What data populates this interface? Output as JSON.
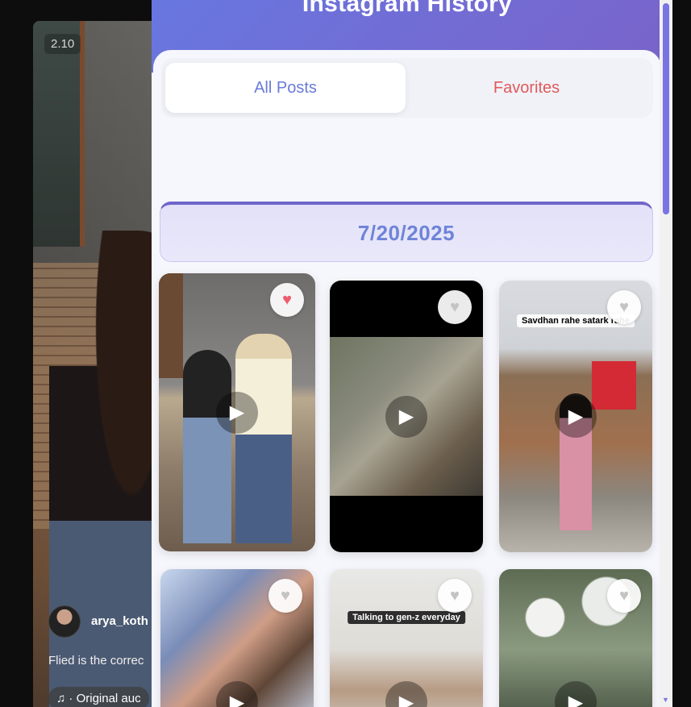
{
  "background_video": {
    "timestamp": "2.10",
    "username": "arya_koth",
    "caption": "Flied is the correc",
    "audio_label": "♫ · Original auc"
  },
  "panel": {
    "title": "Instagram History",
    "tabs": [
      {
        "label": "All Posts",
        "active": true
      },
      {
        "label": "Favorites",
        "active": false
      }
    ],
    "date_group": "7/20/2025",
    "posts": [
      {
        "favorited": true,
        "overlay_text": ""
      },
      {
        "favorited": false,
        "overlay_text": ""
      },
      {
        "favorited": false,
        "overlay_text": "Savdhan rahe satark rahe"
      },
      {
        "favorited": false,
        "overlay_text": ""
      },
      {
        "favorited": false,
        "overlay_text": "Talking to gen-z everyday"
      },
      {
        "favorited": false,
        "overlay_text": ""
      }
    ]
  },
  "icons": {
    "favorite": "heart-icon",
    "play": "play-icon",
    "audio": "music-note-icon"
  },
  "colors": {
    "header_gradient_start": "#6877e0",
    "header_gradient_end": "#7a63c9",
    "active_tab_text": "#6a7bd8",
    "favorites_tab_text": "#e05a5a",
    "date_text": "#6f84d8",
    "favorite_on": "#ef5b6e",
    "favorite_off": "#c4c4c4"
  }
}
